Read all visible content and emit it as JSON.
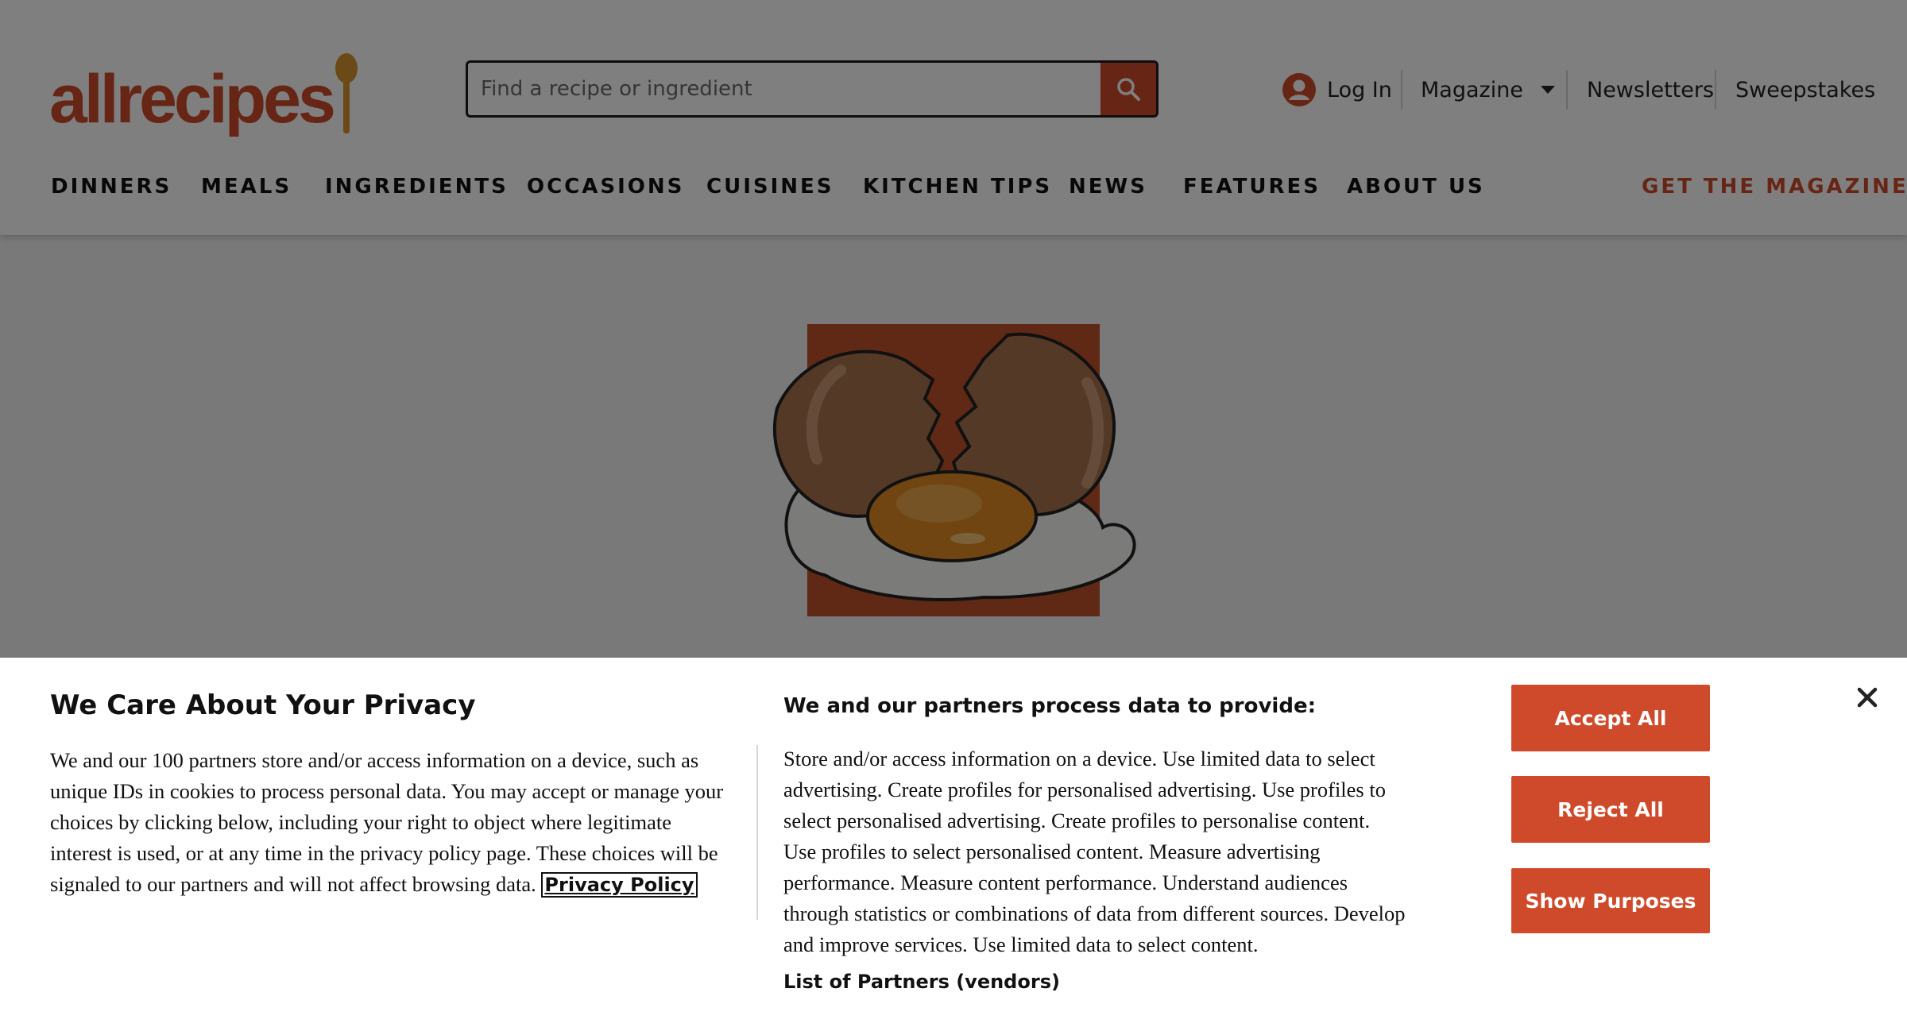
{
  "brand": {
    "name": "allrecipes",
    "accent": "#ce4a2a",
    "spoon_color": "#d9952e"
  },
  "search": {
    "placeholder": "Find a recipe or ingredient",
    "icon": "search-icon"
  },
  "utility": {
    "login_label": "Log In",
    "magazine_label": "Magazine",
    "newsletters_label": "Newsletters",
    "sweepstakes_label": "Sweepstakes"
  },
  "nav": {
    "items": [
      "DINNERS",
      "MEALS",
      "INGREDIENTS",
      "OCCASIONS",
      "CUISINES",
      "KITCHEN TIPS",
      "NEWS",
      "FEATURES",
      "ABOUT US"
    ],
    "cta": "GET THE MAGAZINE"
  },
  "privacy": {
    "title": "We Care About Your Privacy",
    "body": "We and our 100 partners store and/or access information on a device, such as unique IDs in cookies to process personal data. You may accept or manage your choices by clicking below, including your right to object where legitimate interest is used, or at any time in the privacy policy page. These choices will be signaled to our partners and will not affect browsing data.",
    "policy_link": "Privacy Policy",
    "purposes_heading": "We and our partners process data to provide:",
    "purposes_text": "Store and/or access information on a device. Use limited data to select advertising. Create profiles for personalised advertising. Use profiles to select personalised advertising. Create profiles to personalise content. Use profiles to select personalised content. Measure advertising performance. Measure content performance. Understand audiences through statistics or combinations of data from different sources. Develop and improve services. Use limited data to select content.",
    "vendors_link": "List of Partners (vendors)",
    "accept_label": "Accept All",
    "reject_label": "Reject All",
    "show_label": "Show Purposes"
  }
}
